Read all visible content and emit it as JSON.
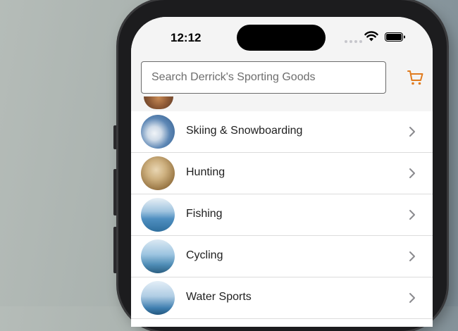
{
  "status_bar": {
    "time": "12:12"
  },
  "header": {
    "search_placeholder": "Search Derrick's Sporting Goods"
  },
  "icons": {
    "cart": "shopping-cart-icon",
    "chevron": "chevron-right-icon"
  },
  "colors": {
    "accent": "#e07b1e",
    "chevron": "#8a8a8e"
  },
  "categories": [
    {
      "label": "Skiing & Snowboarding",
      "thumb": "skiing-thumbnail"
    },
    {
      "label": "Hunting",
      "thumb": "hunting-thumbnail"
    },
    {
      "label": "Fishing",
      "thumb": "fishing-thumbnail"
    },
    {
      "label": "Cycling",
      "thumb": "cycling-thumbnail"
    },
    {
      "label": "Water Sports",
      "thumb": "water-sports-thumbnail"
    }
  ]
}
